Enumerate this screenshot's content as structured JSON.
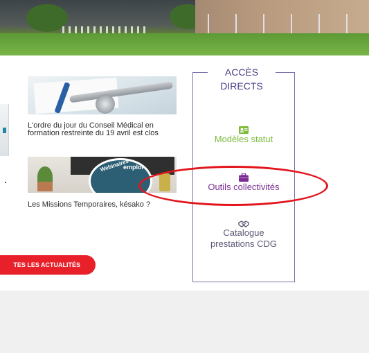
{
  "news": [
    {
      "caption": "L'ordre du jour du Conseil Médical en formation restreinte du 19 avril est clos",
      "image_icon": "stethoscope-image"
    },
    {
      "caption": "Les Missions Temporaires, késako ?",
      "image_icon": "webinaires-emploi-image",
      "badge_text_1": "Webinaires",
      "badge_text_2": "emploi"
    }
  ],
  "all_news_button": {
    "label": "TES LES ACTUALITÉS"
  },
  "access_panel": {
    "title_line1": "ACCÈS",
    "title_line2": "DIRECTS",
    "items": [
      {
        "label": "Modèles statut",
        "icon": "id-card-icon",
        "color": "#7dbb3b"
      },
      {
        "label": "Outils collectivités",
        "icon": "briefcase-icon",
        "color": "#7b2a95"
      },
      {
        "label_line1": "Catalogue",
        "label_line2": "prestations CDG",
        "icon": "handshake-icon",
        "color": "#5d5a78"
      }
    ]
  },
  "colors": {
    "accent_red": "#e8202a",
    "panel_border": "#7a6fab",
    "highlight": "#e3151c"
  }
}
